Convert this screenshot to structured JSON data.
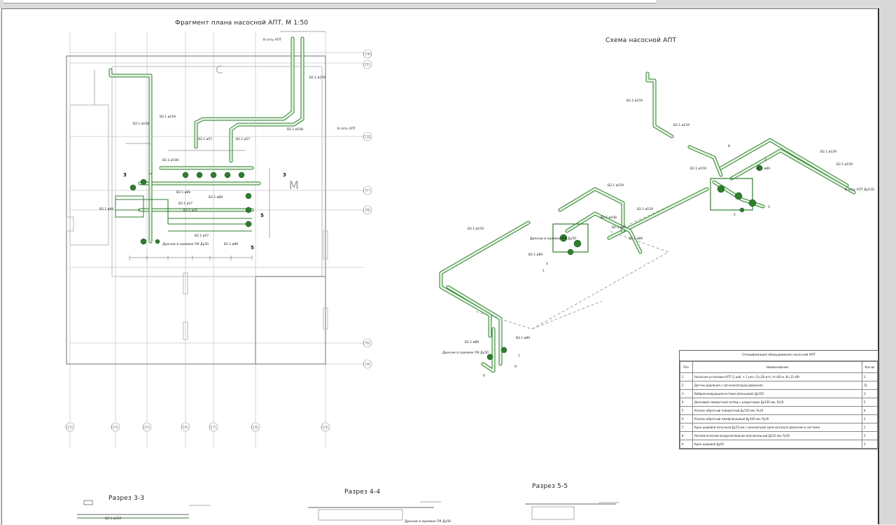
{
  "titles": {
    "plan": "Фрагмент плана насосной АПТ. М 1:50",
    "scheme": "Схема насосной АПТ",
    "section33": "Разрез 3-3",
    "section44": "Разрез 4-4",
    "section55": "Разрез 5-5"
  },
  "grid_bubbles": {
    "right": [
      "(7Ж)",
      "(7Е)",
      "(7Д)",
      "(7Г)",
      "(7В)",
      "(7Б)",
      "(7А)"
    ],
    "bottom": [
      "(13)",
      "(14)",
      "(15)",
      "(16)",
      "(17)",
      "(18)",
      "(19)"
    ]
  },
  "plan_labels": {
    "pipe_main": "В2.1 ø159",
    "pipe_100": "В2.1 ø108",
    "pipe_89": "В2.1 ø89",
    "pipe_57": "В2.1 ø57",
    "pipe_32": "В2.1 ø32",
    "to_net": "В сеть АПТ",
    "section_3": "3",
    "section_5": "5",
    "room_m": "М",
    "room_s": "С",
    "drain": "Дренаж в приямок ПК Ду50"
  },
  "scheme_labels": {
    "pipe_main": "В2.1 ø159",
    "pipe_108": "В2.1 ø108",
    "pipe_89": "В2.1 ø89",
    "to_net": "В сеть АПТ Ду150",
    "drain": "Дренаж в приямок ПК Ду50",
    "mark_1": "1",
    "mark_2": "2",
    "mark_3": "3",
    "mark_4": "4",
    "mark_5": "5",
    "mark_6": "6",
    "mark_7": "7",
    "mark_8": "8",
    "mark_9": "9"
  },
  "spec": {
    "title": "Спецификация оборудования насосной АПТ",
    "headers": [
      "Поз.",
      "Наименование",
      "Кол-во"
    ],
    "rows": [
      [
        "1",
        "Насосная установка АПТ (1 раб. + 1 рез.) Q=26 м³/ч, H=60 м, N=15 кВт",
        "1"
      ],
      [
        "2",
        "Датчик давления с сигнализатором давления",
        "11"
      ],
      [
        "3",
        "Виброизолирующая вставка фланцевая Ду150",
        "3"
      ],
      [
        "4",
        "Дисковый поворотный затвор с редуктором Ду150 мм, Ру16",
        "5"
      ],
      [
        "5",
        "Клапан обратный поворотный Ду150 мм, Ру16",
        "4"
      ],
      [
        "6",
        "Клапан обратный межфланцевый Ду100 мм, Ру16",
        "3"
      ],
      [
        "7",
        "Кран шаровой латунный Ду15 мм с манометром (для контроля давления в системе)",
        "1"
      ],
      [
        "8",
        "Автоматический воздухоотводчик вертикальный Ду15 мм, Ру10",
        "3"
      ],
      [
        "9",
        "Кран шаровой Ду20",
        "3"
      ]
    ]
  }
}
